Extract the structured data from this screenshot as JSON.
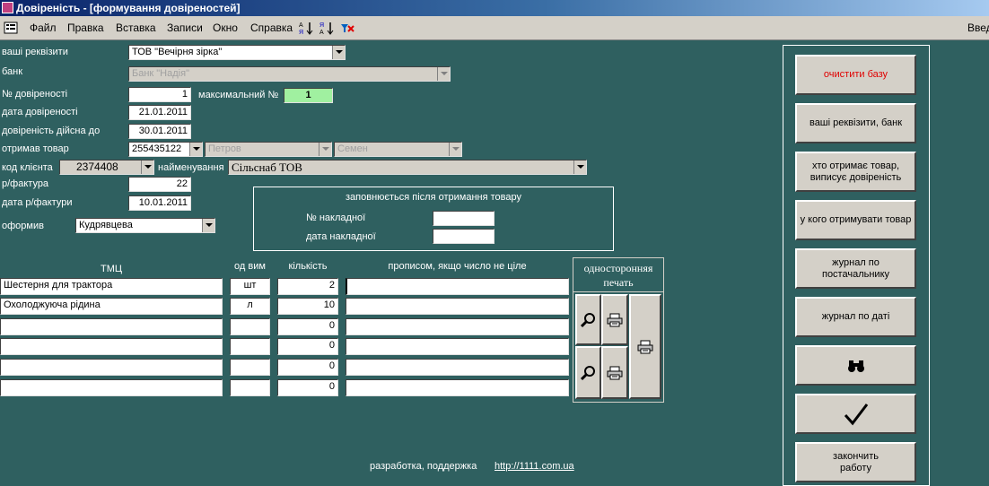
{
  "window": {
    "title": "Довіреність - [формування довіреностей]"
  },
  "menu": {
    "items": [
      "Файл",
      "Правка",
      "Вставка",
      "Записи",
      "Окно",
      "Справка"
    ],
    "right_text": "Введ"
  },
  "form": {
    "rekvizyty_label": "ваші реквізити",
    "rekvizyty_value": "ТОВ \"Вечірня зірка\"",
    "bank_label": "банк",
    "bank_value": "Банк \"Надія\"",
    "nomer_label": "№ довіреності",
    "nomer_value": "1",
    "max_label": "максимальний №",
    "max_value": "1",
    "data_label": "дата довіреності",
    "data_value": "21.01.2011",
    "diisna_label": "довіреність дійсна до",
    "diisna_value": "30.01.2011",
    "otrymav_label": "отримав товар",
    "otrymav_code": "255435122",
    "otrymav_surname": "Петров",
    "otrymav_name": "Семен",
    "kod_label": "код клієнта",
    "kod_value": "2374408",
    "naim_label": "найменування",
    "naim_value": "Сільснаб ТОВ",
    "faktura_label": "р/фактура",
    "faktura_value": "22",
    "data_faktury_label": "дата р/фактури",
    "data_faktury_value": "10.01.2011",
    "oformyv_label": "оформив",
    "oformyv_value": "Кудрявцева"
  },
  "after_receipt": {
    "title": "заповнюється після отримання товару",
    "nakladna_label": "№ накладної",
    "nakladna_value": "",
    "data_nakladnoi_label": "дата накладної",
    "data_nakladnoi_value": ""
  },
  "table": {
    "headers": {
      "tmc": "ТМЦ",
      "unit": "од вим",
      "qty": "кількість",
      "words": "прописом, якщо число не ціле"
    },
    "rows": [
      {
        "name": "Шестерня для трактора",
        "unit": "шт",
        "qty": "2",
        "words": ""
      },
      {
        "name": "Охолоджуюча рідина",
        "unit": "л",
        "qty": "10",
        "words": ""
      },
      {
        "name": "",
        "unit": "",
        "qty": "0",
        "words": ""
      },
      {
        "name": "",
        "unit": "",
        "qty": "0",
        "words": ""
      },
      {
        "name": "",
        "unit": "",
        "qty": "0",
        "words": ""
      },
      {
        "name": "",
        "unit": "",
        "qty": "0",
        "words": ""
      }
    ]
  },
  "print_panel": {
    "line1": "односторонняя",
    "line2": "печать"
  },
  "buttons": {
    "clear": "очистити базу",
    "requisites": "ваші реквізити, банк",
    "receiver_l1": "хто отримає товар,",
    "receiver_l2": "виписує довіреність",
    "supplier": "у кого отримувати товар",
    "journal_supplier_l1": "журнал по",
    "journal_supplier_l2": "постачальнику",
    "journal_date": "журнал по даті",
    "finish_l1": "закончить",
    "finish_l2": "работу"
  },
  "footer": {
    "text": "разработка, поддержка",
    "link": "http://1111.com.ua"
  },
  "colors": {
    "background": "#2f6060",
    "accent_red": "#e00000",
    "max_field": "#a0f0a0"
  }
}
